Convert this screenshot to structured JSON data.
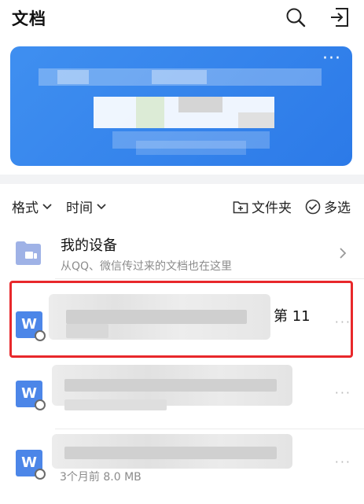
{
  "header": {
    "title": "文档",
    "search_icon": "search-icon",
    "export_icon": "exit-icon"
  },
  "banner": {
    "more_label": "···"
  },
  "filters": {
    "format_label": "格式",
    "time_label": "时间",
    "folder_label": "文件夹",
    "multiselect_label": "多选"
  },
  "my_device": {
    "title": "我的设备",
    "subtitle": "从QQ、微信传过来的文档也在这里"
  },
  "files": [
    {
      "visible_title_suffix": "第 11",
      "icon_letter": "W",
      "meta": ""
    },
    {
      "visible_title_suffix": "",
      "icon_letter": "W",
      "meta": ""
    },
    {
      "visible_title_suffix": "",
      "icon_letter": "W",
      "meta": "3个月前   8.0 MB"
    }
  ],
  "colors": {
    "accent": "#3f8ff0",
    "word_icon": "#4c86e8",
    "highlight": "#e8282b"
  }
}
